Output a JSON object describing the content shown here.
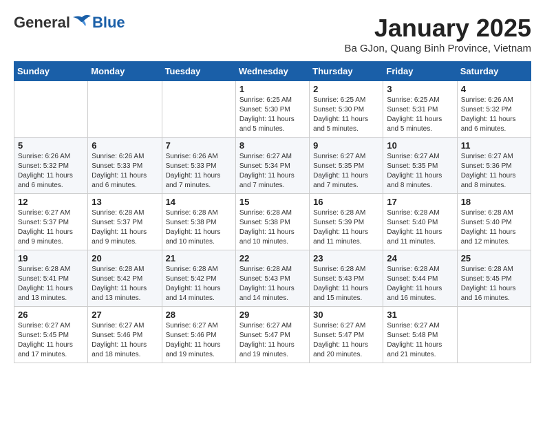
{
  "logo": {
    "general": "General",
    "blue": "Blue"
  },
  "header": {
    "month_title": "January 2025",
    "location": "Ba GJon, Quang Binh Province, Vietnam"
  },
  "weekdays": [
    "Sunday",
    "Monday",
    "Tuesday",
    "Wednesday",
    "Thursday",
    "Friday",
    "Saturday"
  ],
  "weeks": [
    [
      {
        "day": "",
        "info": ""
      },
      {
        "day": "",
        "info": ""
      },
      {
        "day": "",
        "info": ""
      },
      {
        "day": "1",
        "info": "Sunrise: 6:25 AM\nSunset: 5:30 PM\nDaylight: 11 hours\nand 5 minutes."
      },
      {
        "day": "2",
        "info": "Sunrise: 6:25 AM\nSunset: 5:30 PM\nDaylight: 11 hours\nand 5 minutes."
      },
      {
        "day": "3",
        "info": "Sunrise: 6:25 AM\nSunset: 5:31 PM\nDaylight: 11 hours\nand 5 minutes."
      },
      {
        "day": "4",
        "info": "Sunrise: 6:26 AM\nSunset: 5:32 PM\nDaylight: 11 hours\nand 6 minutes."
      }
    ],
    [
      {
        "day": "5",
        "info": "Sunrise: 6:26 AM\nSunset: 5:32 PM\nDaylight: 11 hours\nand 6 minutes."
      },
      {
        "day": "6",
        "info": "Sunrise: 6:26 AM\nSunset: 5:33 PM\nDaylight: 11 hours\nand 6 minutes."
      },
      {
        "day": "7",
        "info": "Sunrise: 6:26 AM\nSunset: 5:33 PM\nDaylight: 11 hours\nand 7 minutes."
      },
      {
        "day": "8",
        "info": "Sunrise: 6:27 AM\nSunset: 5:34 PM\nDaylight: 11 hours\nand 7 minutes."
      },
      {
        "day": "9",
        "info": "Sunrise: 6:27 AM\nSunset: 5:35 PM\nDaylight: 11 hours\nand 7 minutes."
      },
      {
        "day": "10",
        "info": "Sunrise: 6:27 AM\nSunset: 5:35 PM\nDaylight: 11 hours\nand 8 minutes."
      },
      {
        "day": "11",
        "info": "Sunrise: 6:27 AM\nSunset: 5:36 PM\nDaylight: 11 hours\nand 8 minutes."
      }
    ],
    [
      {
        "day": "12",
        "info": "Sunrise: 6:27 AM\nSunset: 5:37 PM\nDaylight: 11 hours\nand 9 minutes."
      },
      {
        "day": "13",
        "info": "Sunrise: 6:28 AM\nSunset: 5:37 PM\nDaylight: 11 hours\nand 9 minutes."
      },
      {
        "day": "14",
        "info": "Sunrise: 6:28 AM\nSunset: 5:38 PM\nDaylight: 11 hours\nand 10 minutes."
      },
      {
        "day": "15",
        "info": "Sunrise: 6:28 AM\nSunset: 5:38 PM\nDaylight: 11 hours\nand 10 minutes."
      },
      {
        "day": "16",
        "info": "Sunrise: 6:28 AM\nSunset: 5:39 PM\nDaylight: 11 hours\nand 11 minutes."
      },
      {
        "day": "17",
        "info": "Sunrise: 6:28 AM\nSunset: 5:40 PM\nDaylight: 11 hours\nand 11 minutes."
      },
      {
        "day": "18",
        "info": "Sunrise: 6:28 AM\nSunset: 5:40 PM\nDaylight: 11 hours\nand 12 minutes."
      }
    ],
    [
      {
        "day": "19",
        "info": "Sunrise: 6:28 AM\nSunset: 5:41 PM\nDaylight: 11 hours\nand 13 minutes."
      },
      {
        "day": "20",
        "info": "Sunrise: 6:28 AM\nSunset: 5:42 PM\nDaylight: 11 hours\nand 13 minutes."
      },
      {
        "day": "21",
        "info": "Sunrise: 6:28 AM\nSunset: 5:42 PM\nDaylight: 11 hours\nand 14 minutes."
      },
      {
        "day": "22",
        "info": "Sunrise: 6:28 AM\nSunset: 5:43 PM\nDaylight: 11 hours\nand 14 minutes."
      },
      {
        "day": "23",
        "info": "Sunrise: 6:28 AM\nSunset: 5:43 PM\nDaylight: 11 hours\nand 15 minutes."
      },
      {
        "day": "24",
        "info": "Sunrise: 6:28 AM\nSunset: 5:44 PM\nDaylight: 11 hours\nand 16 minutes."
      },
      {
        "day": "25",
        "info": "Sunrise: 6:28 AM\nSunset: 5:45 PM\nDaylight: 11 hours\nand 16 minutes."
      }
    ],
    [
      {
        "day": "26",
        "info": "Sunrise: 6:27 AM\nSunset: 5:45 PM\nDaylight: 11 hours\nand 17 minutes."
      },
      {
        "day": "27",
        "info": "Sunrise: 6:27 AM\nSunset: 5:46 PM\nDaylight: 11 hours\nand 18 minutes."
      },
      {
        "day": "28",
        "info": "Sunrise: 6:27 AM\nSunset: 5:46 PM\nDaylight: 11 hours\nand 19 minutes."
      },
      {
        "day": "29",
        "info": "Sunrise: 6:27 AM\nSunset: 5:47 PM\nDaylight: 11 hours\nand 19 minutes."
      },
      {
        "day": "30",
        "info": "Sunrise: 6:27 AM\nSunset: 5:47 PM\nDaylight: 11 hours\nand 20 minutes."
      },
      {
        "day": "31",
        "info": "Sunrise: 6:27 AM\nSunset: 5:48 PM\nDaylight: 11 hours\nand 21 minutes."
      },
      {
        "day": "",
        "info": ""
      }
    ]
  ]
}
